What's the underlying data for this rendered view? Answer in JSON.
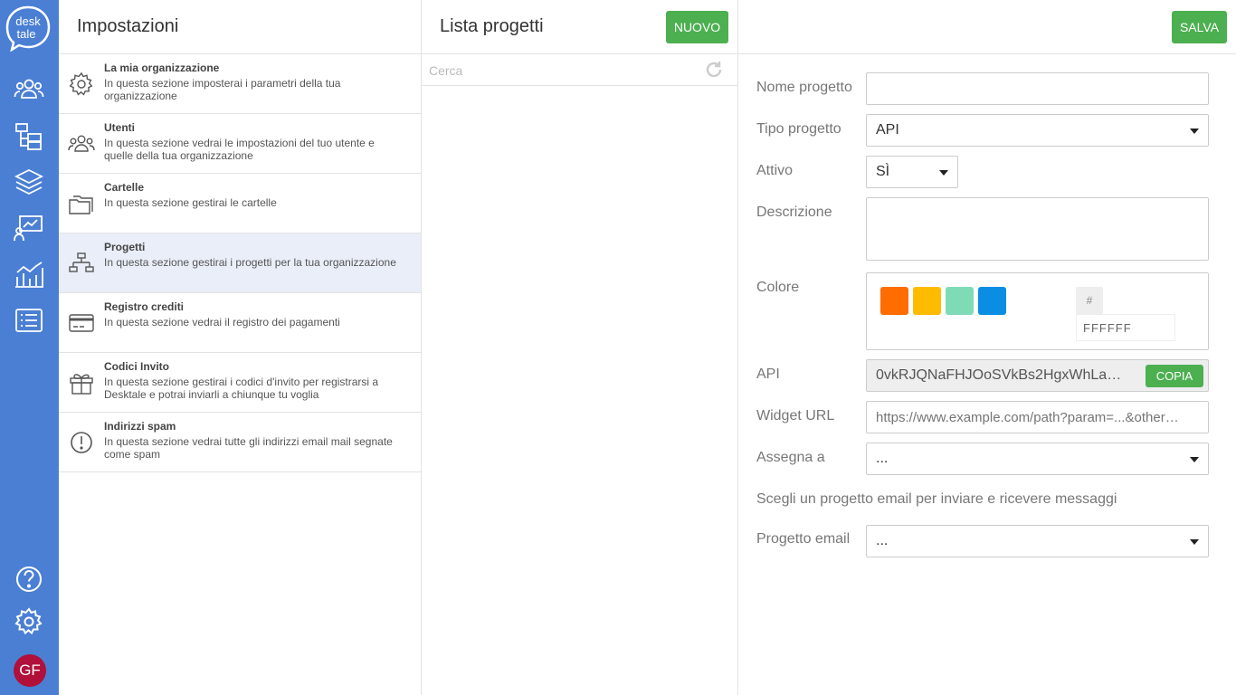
{
  "app": {
    "logo_text": "desk tale",
    "avatar_initials": "GF"
  },
  "rail": {
    "icons": [
      "users-icon",
      "folders-tree-icon",
      "layers-icon",
      "presentation-chart-icon",
      "analytics-icon",
      "list-icon",
      "help-icon",
      "settings-icon"
    ]
  },
  "settings": {
    "title": "Impostazioni",
    "items": [
      {
        "title": "La mia organizzazione",
        "desc": "In questa sezione imposterai i parametri della tua organizzazione",
        "icon": "gear-icon"
      },
      {
        "title": "Utenti",
        "desc": "In questa sezione vedrai le impostazioni del tuo utente e quelle della tua organizzazione",
        "icon": "users-icon"
      },
      {
        "title": "Cartelle",
        "desc": "In questa sezione gestirai le cartelle",
        "icon": "folders-icon"
      },
      {
        "title": "Progetti",
        "desc": "In questa sezione gestirai i progetti per la tua organizzazione",
        "icon": "sitemap-icon"
      },
      {
        "title": "Registro crediti",
        "desc": "In questa sezione vedrai il registro dei pagamenti",
        "icon": "credit-card-icon"
      },
      {
        "title": "Codici Invito",
        "desc": "In questa sezione gestirai i codici d'invito per registrarsi a Desktale e potrai inviarli a chiunque tu voglia",
        "icon": "gift-icon"
      },
      {
        "title": "Indirizzi spam",
        "desc": "In questa sezione vedrai tutte gli indirizzi email mail segnate come spam",
        "icon": "alert-circle-icon"
      }
    ],
    "active_index": 3
  },
  "list": {
    "title": "Lista progetti",
    "new_label": "NUOVO",
    "search_placeholder": "Cerca"
  },
  "form": {
    "save_label": "SALVA",
    "name_label": "Nome progetto",
    "name_value": "",
    "type_label": "Tipo progetto",
    "type_value": "API",
    "active_label": "Attivo",
    "active_value": "SÌ",
    "desc_label": "Descrizione",
    "desc_value": "",
    "color_label": "Colore",
    "swatches": [
      "#ff6d00",
      "#ffbb00",
      "#7fdbb6",
      "#0a8de3"
    ],
    "hash": "#",
    "hex_value": "FFFFFF",
    "api_label": "API",
    "api_value": "0vkRJQNaFHJOoSVkBs2HgxWhLa…",
    "copy_label": "COPIA",
    "widget_label": "Widget URL",
    "widget_placeholder": "https://www.example.com/path?param=...&other…",
    "assign_label": "Assegna a",
    "assign_value": "...",
    "hint": "Scegli un progetto email per inviare e ricevere messaggi",
    "email_label": "Progetto email",
    "email_value": "..."
  },
  "colors": {
    "rail": "#4a7fd4",
    "green": "#4caf50",
    "active_row": "#e9eef8",
    "avatar": "#b0103a"
  }
}
